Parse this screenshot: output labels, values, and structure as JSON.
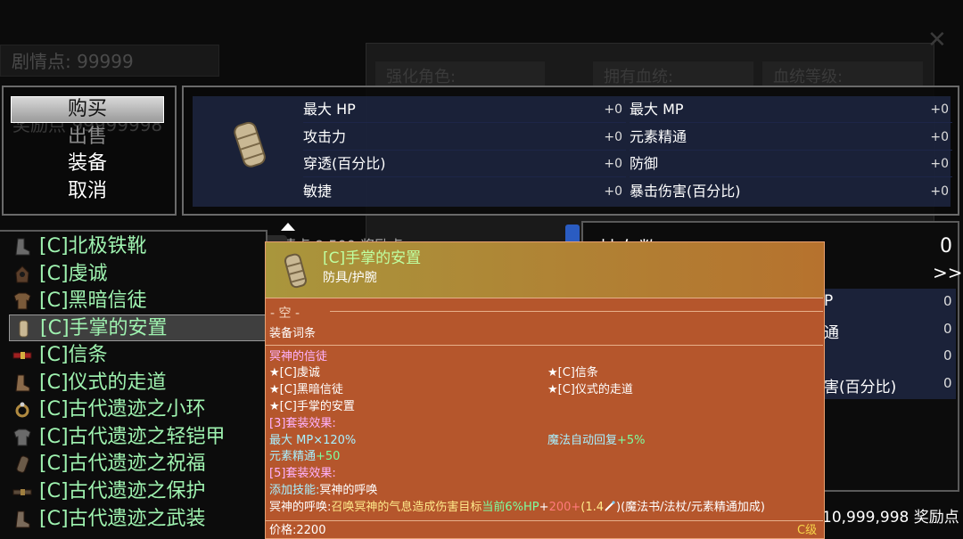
{
  "background": {
    "story_points": "剧情点: 99999",
    "reward_points_ghost": "奖励点 99999998",
    "panel_label_1": "强化角色:",
    "panel_label_2": "拥有血统:",
    "panel_label_3": "血统等级:",
    "close_glyph": "✕"
  },
  "command": {
    "buy": "购买",
    "sell": "出售",
    "equip": "装备",
    "cancel": "取消"
  },
  "stats": [
    {
      "label": "最大 HP",
      "value": "+0"
    },
    {
      "label": "最大 MP",
      "value": "+0"
    },
    {
      "label": "攻击力",
      "value": "+0"
    },
    {
      "label": "元素精通",
      "value": "+0"
    },
    {
      "label": "穿透(百分比)",
      "value": "+0"
    },
    {
      "label": "防御",
      "value": "+0"
    },
    {
      "label": "敏捷",
      "value": "+0"
    },
    {
      "label": "暴击伤害(百分比)",
      "value": "+0"
    }
  ],
  "shop_list": [
    {
      "name": "[C]北极铁靴",
      "icon": "boots-icon"
    },
    {
      "name": "[C]虔诚",
      "icon": "hood-icon"
    },
    {
      "name": "[C]黑暗信徒",
      "icon": "armor-icon"
    },
    {
      "name": "[C]手掌的安置",
      "icon": "bracer-icon"
    },
    {
      "name": "[C]信条",
      "icon": "belt-icon"
    },
    {
      "name": "[C]仪式的走道",
      "icon": "boots-icon"
    },
    {
      "name": "[C]古代遗迹之小环",
      "icon": "ring-icon"
    },
    {
      "name": "[C]古代遗迹之轻铠甲",
      "icon": "armor-icon"
    },
    {
      "name": "[C]古代遗迹之祝福",
      "icon": "bracer-icon"
    },
    {
      "name": "[C]古代遗迹之保护",
      "icon": "belt-icon"
    },
    {
      "name": "[C]古代遗迹之武装",
      "icon": "boots-icon"
    }
  ],
  "strip_text": "剧情点 9,500 奖励点",
  "right_panel": {
    "title": "持有数",
    "count": "0",
    "more": ">>",
    "rows": [
      {
        "label": "P",
        "value": "0"
      },
      {
        "label": "通",
        "value": "0"
      },
      {
        "label": "",
        "value": "0"
      },
      {
        "label": "害(百分比)",
        "value": "0"
      }
    ]
  },
  "bottom_status": "10,999,998 奖励点",
  "tooltip": {
    "name": "[C]手掌的安置",
    "type": "防具/护腕",
    "empty": "- 空 -",
    "affix_header": "装备词条",
    "set_name": "冥神的信徒",
    "set_items": [
      "★[C]虔诚",
      "★[C]信条",
      "★[C]黑暗信徒",
      "★[C]仪式的走道",
      "★[C]手掌的安置"
    ],
    "bonus3_header": "[3]套装效果:",
    "bonus3_a": "最大 MP×120%",
    "bonus3_b_label": "魔法自动回复",
    "bonus3_b_value": "+5%",
    "bonus3_c_label": "元素精通",
    "bonus3_c_value": "+50",
    "bonus5_header": "[5]套装效果:",
    "skill_prefix": "添加技能:",
    "skill_name": "冥神的呼唤",
    "desc_prefix": "冥神的呼唤:",
    "desc_main": "召唤冥神的气息造成伤害目标",
    "desc_hp": "当前6%HP",
    "desc_plus1": "+",
    "desc_red": "200+",
    "desc_mult": "(1.4",
    "desc_tail": ")(魔法书/法杖/元素精通加成)",
    "price": "价格:2200",
    "grade": "C级"
  }
}
